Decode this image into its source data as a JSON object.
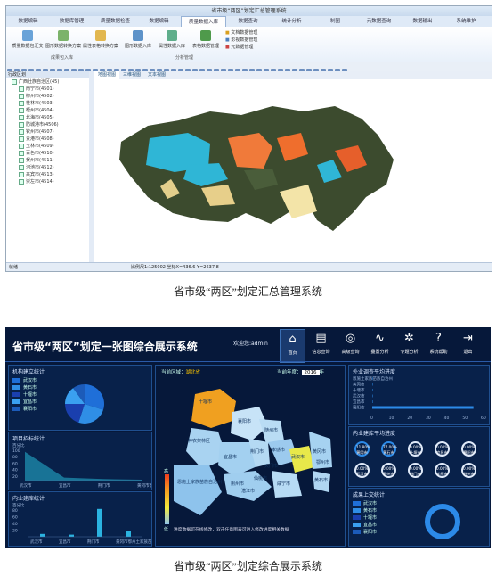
{
  "top_app": {
    "title": "省市级“两区”划定汇总管理系统",
    "tabs": [
      "数据编辑",
      "数据库管理",
      "质量数据检查",
      "数据编辑",
      "质量数据入库",
      "数据查询",
      "统计分析",
      "制图",
      "元数据查询",
      "数据输出",
      "系统维护"
    ],
    "active_tab_index": 4,
    "ribbon_buttons": [
      "质量数据包汇交",
      "图形数据转换方案",
      "属性表格转换方案",
      "图形数据入库",
      "属性数据入库",
      "表格数据管理"
    ],
    "ribbon_small_items": [
      "文档数据管理",
      "影视数据管理",
      "元数据管理"
    ],
    "group_labels": [
      "成果包入库",
      "分析管理"
    ],
    "map_tabs": [
      "地图视图",
      "三维视图",
      "文本视图"
    ],
    "tree_header": "行政区划",
    "tree_root": "广西壮族自治区(45)",
    "tree_items": [
      "南宁市(4501)",
      "柳州市(4502)",
      "桂林市(4503)",
      "梧州市(4504)",
      "北海市(4505)",
      "防城港市(4506)",
      "钦州市(4507)",
      "贵港市(4508)",
      "玉林市(4509)",
      "百色市(4510)",
      "贺州市(4511)",
      "河池市(4512)",
      "来宾市(4513)",
      "崇左市(4514)"
    ],
    "status_text": "比例尺1:125002  坐标X=436.6 Y=2637.8",
    "status_left": "就绪"
  },
  "captions": {
    "top": "省市级“两区”划定汇总管理系统",
    "bottom": "省市级“两区”划定综合展示系统"
  },
  "dashboard": {
    "title": "省市级“两区”划定一张图综合展示系统",
    "welcome": "欢迎您:admin",
    "nav": [
      {
        "label": "首页",
        "icon": "home-icon",
        "glyph": "⌂"
      },
      {
        "label": "信息查询",
        "icon": "chart-icon",
        "glyph": "▤"
      },
      {
        "label": "高级查询",
        "icon": "globe-icon",
        "glyph": "◎"
      },
      {
        "label": "叠置分析",
        "icon": "pulse-icon",
        "glyph": "∿"
      },
      {
        "label": "专题分析",
        "icon": "gear-icon",
        "glyph": "✲"
      },
      {
        "label": "系统帮助",
        "icon": "help-icon",
        "glyph": "?"
      },
      {
        "label": "退出",
        "icon": "logout-icon",
        "glyph": "⇥"
      }
    ],
    "active_nav_index": 0,
    "region_label": "当前区域：",
    "region_value": "湖北省",
    "year_label": "当前年度：",
    "year_value": "2016",
    "year_suffix": "年",
    "panels": {
      "org_stats": {
        "title": "机构建立统计",
        "legend": [
          "武汉市",
          "黄石市",
          "十堰市",
          "宜昌市",
          "襄阳市"
        ],
        "colors": [
          "#1f6fd8",
          "#2f8ee6",
          "#1a3fae",
          "#3aa0f0",
          "#1c5bb9"
        ],
        "chart_data": {
          "type": "pie",
          "categories": [
            "武汉市",
            "黄石市",
            "十堰市",
            "宜昌市",
            "襄阳市"
          ],
          "values": [
            30,
            25,
            20,
            15,
            10
          ]
        }
      },
      "bidding": {
        "title": "项目招标统计",
        "ylabel": "百分比",
        "ytick_labels": [
          "100",
          "80",
          "60",
          "40",
          "20"
        ],
        "categories": [
          "武汉市",
          "宜昌市",
          "荆门市",
          "黄冈市鄂州土家族苗族自治"
        ],
        "chart_data": {
          "type": "area",
          "categories": [
            "武汉市",
            "宜昌市",
            "荆门市",
            "黄冈市鄂州土家族苗族自治"
          ],
          "values": [
            95,
            10,
            5,
            3
          ],
          "ylim": [
            0,
            100
          ]
        }
      },
      "indoor": {
        "title": "内业建库统计",
        "ylabel": "百分比",
        "ytick_labels": [
          "80",
          "60",
          "40",
          "20"
        ],
        "categories": [
          "武汉市",
          "宜昌市",
          "荆门市",
          "黄冈市鄂州土家族苗族自治"
        ],
        "chart_data": {
          "type": "bar",
          "categories": [
            "武汉市",
            "宜昌市",
            "荆门市",
            "黄冈市鄂州土家族苗族自治"
          ],
          "values": [
            8,
            6,
            78,
            15
          ],
          "ylim": [
            0,
            80
          ]
        }
      },
      "field_progress": {
        "title": "外业调查平均进度",
        "categories": [
          "恩施土家族苗族自治州",
          "黄冈市",
          "十堰市",
          "武汉市",
          "宜昌市",
          "襄阳市"
        ],
        "xtick_labels": [
          "0",
          "10",
          "20",
          "30",
          "40",
          "50",
          "60"
        ],
        "chart_data": {
          "type": "bar",
          "categories": [
            "恩施土家族苗族自治州",
            "黄冈市",
            "十堰市",
            "宜昌市",
            "襄阳市",
            "武汉市"
          ],
          "values": [
            0,
            0,
            0,
            0,
            0,
            55
          ],
          "xlim": [
            0,
            60
          ]
        }
      },
      "indoor_progress": {
        "title": "内业建库平均进度",
        "rings": [
          {
            "pct": "11.80%",
            "name": "黄冈市"
          },
          {
            "pct": "77.00%",
            "name": "黄石市"
          },
          {
            "pct": "0.00%",
            "name": "十堰市"
          },
          {
            "pct": "0.00%",
            "name": "宜昌市"
          },
          {
            "pct": "0.00%",
            "name": "襄阳市"
          },
          {
            "pct": "0.00%",
            "name": "武汉市"
          },
          {
            "pct": "0.00%",
            "name": "鄂州市"
          },
          {
            "pct": "0.00%",
            "name": "荆门市"
          },
          {
            "pct": "0.00%",
            "name": "孝感市"
          },
          {
            "pct": "0.00%",
            "name": "荆州市"
          }
        ]
      },
      "results": {
        "title": "成果上交统计",
        "legend": [
          "武汉市",
          "黄石市",
          "十堰市",
          "宜昌市",
          "襄阳市"
        ],
        "colors": [
          "#1f6fd8",
          "#2f8ee6",
          "#1a3fae",
          "#3aa0f0",
          "#1c5bb9"
        ]
      }
    },
    "map": {
      "cities": [
        "十堰市",
        "襄阳市",
        "随州市",
        "神农架林区",
        "宜昌市",
        "荆门市",
        "孝感市",
        "武汉市",
        "黄冈市",
        "鄂州市",
        "黄石市",
        "恩施土家族苗族自治州",
        "荆州市",
        "仙桃市",
        "潜江市",
        "天门市",
        "咸宁市"
      ],
      "note": "进度数据可在线修改，双击任意图表可进入修改进度相关数据",
      "scale_high": "高",
      "scale_low": "低"
    }
  }
}
